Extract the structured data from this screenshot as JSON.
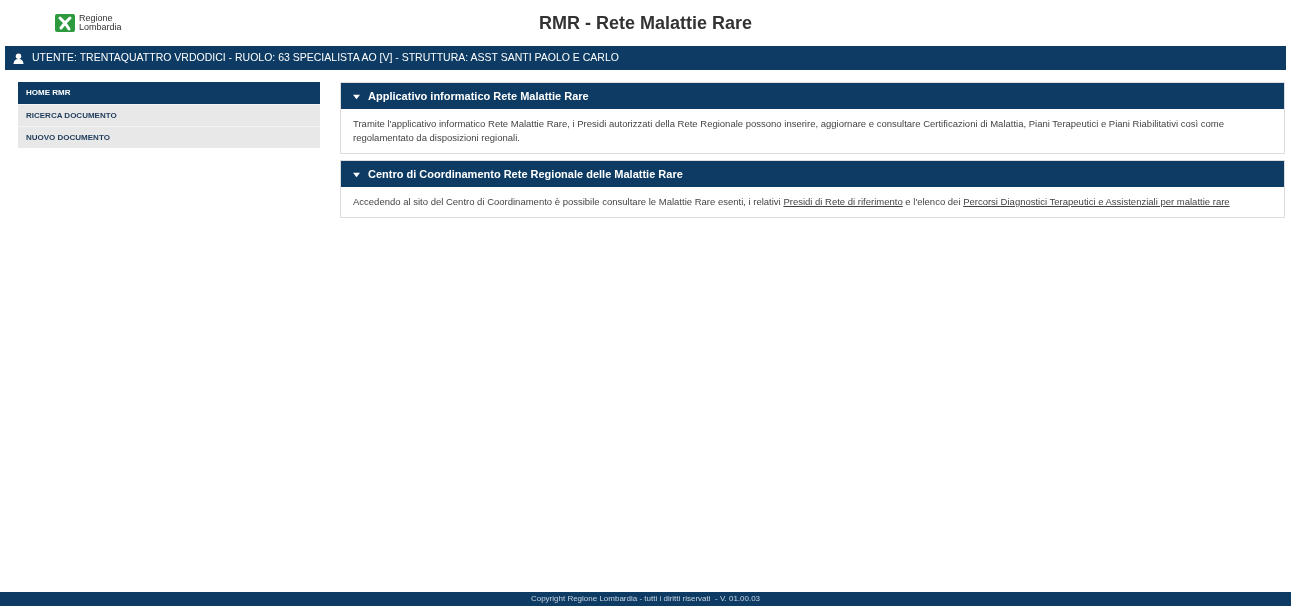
{
  "header": {
    "logo_text": [
      "Regione",
      "Lombardia"
    ],
    "title": "RMR - Rete Malattie Rare"
  },
  "user_bar": {
    "text": "UTENTE: TRENTAQUATTRO VRDODICI - RUOLO: 63 SPECIALISTA AO [V] - STRUTTURA: ASST SANTI PAOLO E CARLO"
  },
  "sidebar": {
    "items": [
      {
        "label": "HOME RMR",
        "selected": true
      },
      {
        "label": "RICERCA DOCUMENTO",
        "selected": false
      },
      {
        "label": "NUOVO DOCUMENTO",
        "selected": false
      }
    ]
  },
  "panels": [
    {
      "title": "Applicativo informatico Rete Malattie Rare",
      "expanded": true,
      "body": [
        {
          "kind": "text",
          "text": "Tramite l'applicativo informatico Rete Malattie Rare, i Presidi autorizzati della Rete Regionale possono inserire, aggiornare e consultare Certificazioni di Malattia, Piani Terapeutici e Piani Riabilitativi così come regolamentato da disposizioni regionali."
        }
      ]
    },
    {
      "title": "Centro di Coordinamento Rete Regionale delle Malattie Rare",
      "expanded": true,
      "body": [
        {
          "kind": "text",
          "text": "Accedendo al sito del Centro di Coordinamento è possibile consultare le Malattie Rare esenti, i relativi "
        },
        {
          "kind": "link",
          "text": "Presidi di Rete di riferimento"
        },
        {
          "kind": "text",
          "text": " e l'elenco dei "
        },
        {
          "kind": "link",
          "text": "Percorsi Diagnostici Terapeutici e Assistenziali per malattie rare"
        }
      ]
    }
  ],
  "footer": {
    "text": "Copyright Regione Lombardia - tutti i diritti riservati  - V. 01.00.03"
  }
}
